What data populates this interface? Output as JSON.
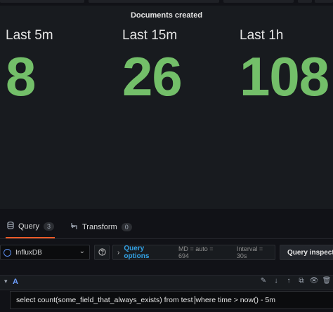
{
  "panel": {
    "title": "Documents created",
    "stats": [
      {
        "label": "Last 5m",
        "value": "8"
      },
      {
        "label": "Last 15m",
        "value": "26"
      },
      {
        "label": "Last 1h",
        "value": "108"
      }
    ],
    "value_color": "#73bf69"
  },
  "tabs": [
    {
      "label": "Query",
      "count": "3",
      "icon": "database-icon",
      "active": true
    },
    {
      "label": "Transform",
      "count": "0",
      "icon": "transform-icon",
      "active": false
    }
  ],
  "query_bar": {
    "datasource": "InfluxDB",
    "query_options_label": "Query options",
    "md": "MD = auto = 694",
    "interval": "Interval = 30s",
    "inspector_label": "Query inspector"
  },
  "query_row": {
    "ref_id": "A",
    "query_before_caret": "select count(some_field_that_always_exists) from test ",
    "query_after_caret": "where time > now() - 5m"
  },
  "accent_color": "#f05a28"
}
